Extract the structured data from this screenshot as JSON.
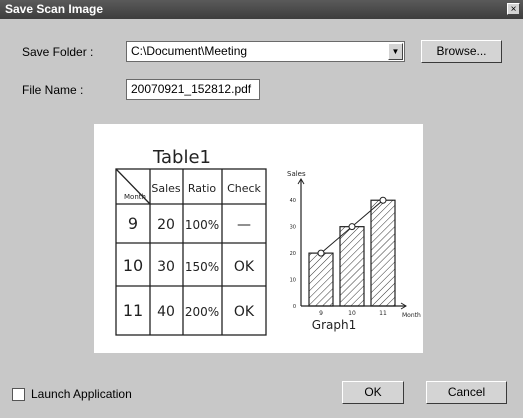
{
  "window": {
    "title": "Save Scan Image",
    "close_glyph": "×"
  },
  "form": {
    "save_folder_label": "Save Folder :",
    "save_folder_value": "C:\\Document\\Meeting",
    "browse_label": "Browse...",
    "file_name_label": "File Name :",
    "file_name_value": "20070921_152812.pdf"
  },
  "preview": {
    "table": {
      "title": "Table1",
      "headers": [
        "Month",
        "Sales",
        "Ratio",
        "Check"
      ],
      "rows": [
        [
          "9",
          "20",
          "100%",
          "—"
        ],
        [
          "10",
          "30",
          "150%",
          "OK"
        ],
        [
          "11",
          "40",
          "200%",
          "OK"
        ]
      ]
    },
    "graph": {
      "caption": "Graph1",
      "ylabel": "Sales",
      "xlabel": "Month",
      "yticks": [
        "0",
        "10",
        "20",
        "30",
        "40"
      ],
      "categories": [
        "9",
        "10",
        "11"
      ],
      "values": [
        20,
        30,
        40
      ]
    }
  },
  "footer": {
    "launch_label": "Launch Application",
    "launch_checked": false,
    "ok_label": "OK",
    "cancel_label": "Cancel"
  }
}
